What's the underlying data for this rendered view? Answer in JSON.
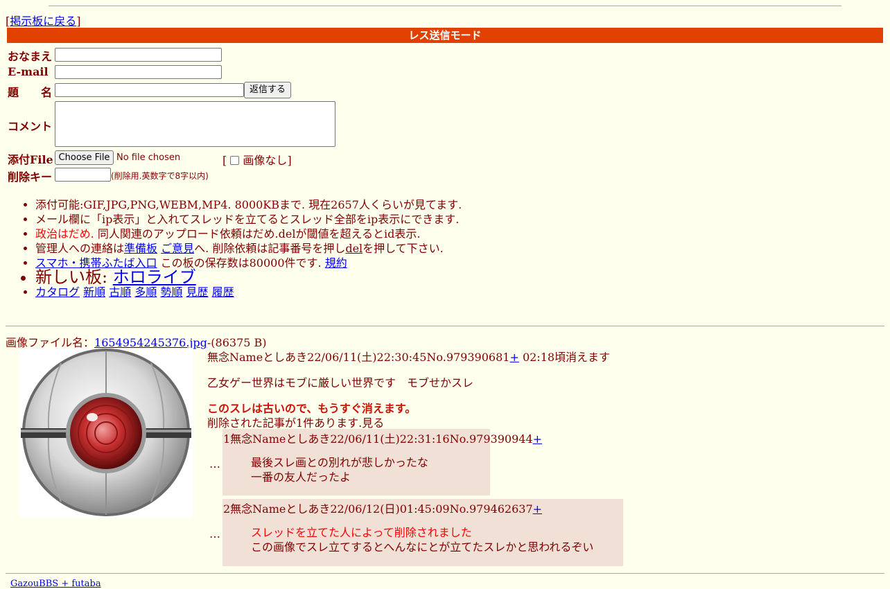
{
  "nav": {
    "back_link": "掲示板に戻る"
  },
  "form": {
    "mode_title": "レス送信モード",
    "name_label": "おなまえ",
    "email_label": "E-mail",
    "subject_label": "題　　名",
    "submit_label": "返信する",
    "comment_label": "コメント",
    "file_label": "添付File",
    "file_button": "Choose File",
    "file_status": "No file chosen",
    "no_image_label": "画像なし",
    "delkey_label": "削除キー",
    "delkey_note": "(削除用.英数字で8字以内)"
  },
  "rules": {
    "line1": "添付可能:GIF,JPG,PNG,WEBM,MP4. 8000KBまで. 現在2657人くらいが見てます.",
    "line2": "メール欄に「ip表示」と入れてスレッドを立てるとスレッド全部をip表示にできます.",
    "line3_red": "政治はだめ.",
    "line3_rest": " 同人関連のアップロード依頼はだめ.delが閾値を超えるとid表示.",
    "line4_a": "管理人への連絡は",
    "line4_link1": "準備板",
    "line4_link2": "ご意見",
    "line4_b": "へ. 削除依頼は記事番号を押し",
    "line4_del": "del",
    "line4_c": "を押して下さい.",
    "line5_link": "スマホ・携帯ふたば入口",
    "line5_text": " この板の保存数は80000件です. ",
    "line5_link2": "規約",
    "line6_text": "新しい板: ",
    "line6_link": "ホロライブ",
    "sort_links": [
      "カタログ",
      "新順",
      "古順",
      "多順",
      "勢順",
      "見歴",
      "履歴"
    ]
  },
  "thread": {
    "file_label": "画像ファイル名：",
    "file_name": "1654954245376.jpg",
    "file_size": "-(86375 B)",
    "op_header": "無念Nameとしあき22/06/11(土)22:30:45No.979390681",
    "op_plus": "+",
    "op_expire": " 02:18頃消えます",
    "op_body": "乙女ゲー世界はモブに厳しい世界です　モブせかスレ",
    "old_warning": "このスレは古いので、もうすぐ消えます。",
    "deleted_notice": "削除された記事が1件あります.見る",
    "replies": [
      {
        "header": "1無念Nameとしあき22/06/11(土)22:31:16No.979390944",
        "plus": "+",
        "red_line": "",
        "lines": [
          "最後スレ画との別れが悲しかったな",
          "一番の友人だったよ"
        ]
      },
      {
        "header": "2無念Nameとしあき22/06/12(日)01:45:09No.979462637",
        "plus": "+",
        "red_line": "スレッドを立てた人によって削除されました",
        "lines": [
          "この画像でスレ立てするとへんなにとが立てたスレかと思われるぞい"
        ]
      }
    ],
    "dots": "…"
  },
  "footer": {
    "text": "GazouBBS + futaba"
  }
}
